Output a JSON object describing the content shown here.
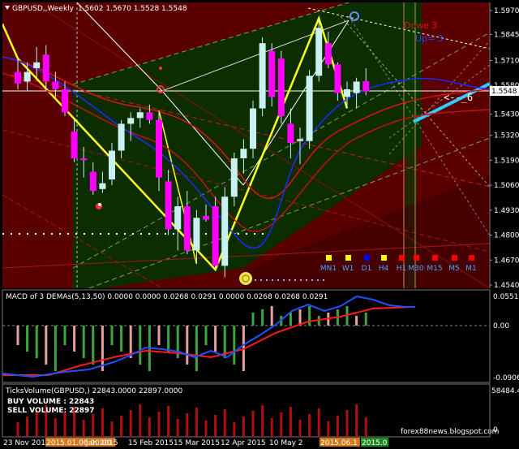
{
  "header": {
    "symbol": "GBPUSD,,Weekly",
    "ohlc": "1.5602 1.5670 1.5528 1.5548"
  },
  "price_label": "1.5548",
  "chart_labels": {
    "arrow": "<--_6",
    "red_tag": "Dowe 3",
    "blue_tag": "Up= 3"
  },
  "timeframes": [
    {
      "label": "MN1",
      "color": "#ffff00"
    },
    {
      "label": "W1",
      "color": "#ffff00"
    },
    {
      "label": "D1",
      "color": "#0000ff"
    },
    {
      "label": "H4",
      "color": "#ffff00"
    },
    {
      "label": "H1",
      "color": "#ff0000"
    },
    {
      "label": "M30",
      "color": "#ff0000"
    },
    {
      "label": "M15",
      "color": "#ff0000"
    },
    {
      "label": "M5",
      "color": "#ff0000"
    },
    {
      "label": "M1",
      "color": "#ff0000"
    }
  ],
  "macd": {
    "title": "MACD of 3 DEMAs(5,13,50) 0.0000 0.0000 0.0268 0.0291 0.0000 0.0268 0.0268 0.0291",
    "y_labels": [
      "0.0551",
      "0.00",
      "-0.0906"
    ]
  },
  "volume": {
    "title": "TicksVolume(GBPUSD,) 22843.0000 22897.0000",
    "buy": "BUY VOLUME : 22843",
    "sell": "SELL VOLUME: 22897",
    "y_labels": [
      "58484.4",
      "0"
    ],
    "watermark": "forex88news.blogspot.com"
  },
  "x_labels": [
    {
      "text": "23 Nov 2014",
      "box": ""
    },
    {
      "text": "2015.01.06 00:00",
      "box": "#d4781c"
    },
    {
      "text": "Jan 2015",
      "box": ""
    },
    {
      "text": "15 Feb 2015",
      "box": ""
    },
    {
      "text": "15 Mar 2015",
      "box": ""
    },
    {
      "text": "12 Apr 2015",
      "box": ""
    },
    {
      "text": "10 May 2",
      "box": ""
    },
    {
      "text": "2015.06.1",
      "box": "#d4781c"
    },
    {
      "text": "2015.0",
      "box": "#1d8a1d"
    }
  ],
  "chart_data": {
    "type": "candlestick",
    "symbol": "GBPUSD",
    "timeframe": "Weekly",
    "y_ticks": [
      1.597,
      1.5845,
      1.571,
      1.558,
      1.543,
      1.532,
      1.519,
      1.506,
      1.493,
      1.48,
      1.467,
      1.454
    ],
    "ylim": [
      1.45,
      1.599
    ],
    "candles": [
      {
        "o": 1.565,
        "h": 1.572,
        "l": 1.556,
        "c": 1.559,
        "dir": "down"
      },
      {
        "o": 1.56,
        "h": 1.57,
        "l": 1.555,
        "c": 1.565,
        "dir": "up"
      },
      {
        "o": 1.567,
        "h": 1.578,
        "l": 1.562,
        "c": 1.57,
        "dir": "up"
      },
      {
        "o": 1.574,
        "h": 1.579,
        "l": 1.555,
        "c": 1.56,
        "dir": "down"
      },
      {
        "o": 1.56,
        "h": 1.565,
        "l": 1.552,
        "c": 1.556,
        "dir": "down"
      },
      {
        "o": 1.556,
        "h": 1.56,
        "l": 1.542,
        "c": 1.544,
        "dir": "down"
      },
      {
        "o": 1.534,
        "h": 1.54,
        "l": 1.518,
        "c": 1.52,
        "dir": "down"
      },
      {
        "o": 1.52,
        "h": 1.526,
        "l": 1.51,
        "c": 1.519,
        "dir": "down"
      },
      {
        "o": 1.513,
        "h": 1.518,
        "l": 1.501,
        "c": 1.503,
        "dir": "down"
      },
      {
        "o": 1.504,
        "h": 1.513,
        "l": 1.502,
        "c": 1.507,
        "dir": "up"
      },
      {
        "o": 1.509,
        "h": 1.528,
        "l": 1.506,
        "c": 1.524,
        "dir": "up"
      },
      {
        "o": 1.524,
        "h": 1.54,
        "l": 1.52,
        "c": 1.538,
        "dir": "up"
      },
      {
        "o": 1.538,
        "h": 1.544,
        "l": 1.529,
        "c": 1.541,
        "dir": "up"
      },
      {
        "o": 1.541,
        "h": 1.546,
        "l": 1.536,
        "c": 1.544,
        "dir": "up"
      },
      {
        "o": 1.544,
        "h": 1.548,
        "l": 1.538,
        "c": 1.54,
        "dir": "down"
      },
      {
        "o": 1.54,
        "h": 1.545,
        "l": 1.503,
        "c": 1.51,
        "dir": "down"
      },
      {
        "o": 1.508,
        "h": 1.514,
        "l": 1.48,
        "c": 1.483,
        "dir": "down"
      },
      {
        "o": 1.483,
        "h": 1.5,
        "l": 1.472,
        "c": 1.495,
        "dir": "up"
      },
      {
        "o": 1.495,
        "h": 1.503,
        "l": 1.47,
        "c": 1.472,
        "dir": "down"
      },
      {
        "o": 1.472,
        "h": 1.493,
        "l": 1.465,
        "c": 1.489,
        "dir": "up"
      },
      {
        "o": 1.488,
        "h": 1.496,
        "l": 1.487,
        "c": 1.49,
        "dir": "down"
      },
      {
        "o": 1.495,
        "h": 1.5,
        "l": 1.462,
        "c": 1.464,
        "dir": "down"
      },
      {
        "o": 1.464,
        "h": 1.505,
        "l": 1.458,
        "c": 1.5,
        "dir": "up"
      },
      {
        "o": 1.5,
        "h": 1.523,
        "l": 1.495,
        "c": 1.52,
        "dir": "up"
      },
      {
        "o": 1.52,
        "h": 1.53,
        "l": 1.512,
        "c": 1.525,
        "dir": "up"
      },
      {
        "o": 1.525,
        "h": 1.55,
        "l": 1.52,
        "c": 1.546,
        "dir": "up"
      },
      {
        "o": 1.546,
        "h": 1.583,
        "l": 1.542,
        "c": 1.58,
        "dir": "up"
      },
      {
        "o": 1.576,
        "h": 1.58,
        "l": 1.547,
        "c": 1.552,
        "dir": "down"
      },
      {
        "o": 1.572,
        "h": 1.576,
        "l": 1.538,
        "c": 1.542,
        "dir": "down"
      },
      {
        "o": 1.538,
        "h": 1.546,
        "l": 1.52,
        "c": 1.528,
        "dir": "down"
      },
      {
        "o": 1.529,
        "h": 1.536,
        "l": 1.517,
        "c": 1.53,
        "dir": "up"
      },
      {
        "o": 1.529,
        "h": 1.566,
        "l": 1.525,
        "c": 1.563,
        "dir": "up"
      },
      {
        "o": 1.563,
        "h": 1.593,
        "l": 1.56,
        "c": 1.588,
        "dir": "up"
      },
      {
        "o": 1.58,
        "h": 1.586,
        "l": 1.567,
        "c": 1.569,
        "dir": "down"
      },
      {
        "o": 1.569,
        "h": 1.57,
        "l": 1.55,
        "c": 1.554,
        "dir": "down"
      },
      {
        "o": 1.552,
        "h": 1.56,
        "l": 1.546,
        "c": 1.556,
        "dir": "up"
      },
      {
        "o": 1.554,
        "h": 1.562,
        "l": 1.546,
        "c": 1.56,
        "dir": "up"
      },
      {
        "o": 1.5602,
        "h": 1.567,
        "l": 1.5528,
        "c": 1.5548,
        "dir": "down"
      }
    ],
    "macd_ylim": [
      -0.0906,
      0.0551
    ],
    "volume_ylim": [
      0,
      58484.4
    ]
  }
}
